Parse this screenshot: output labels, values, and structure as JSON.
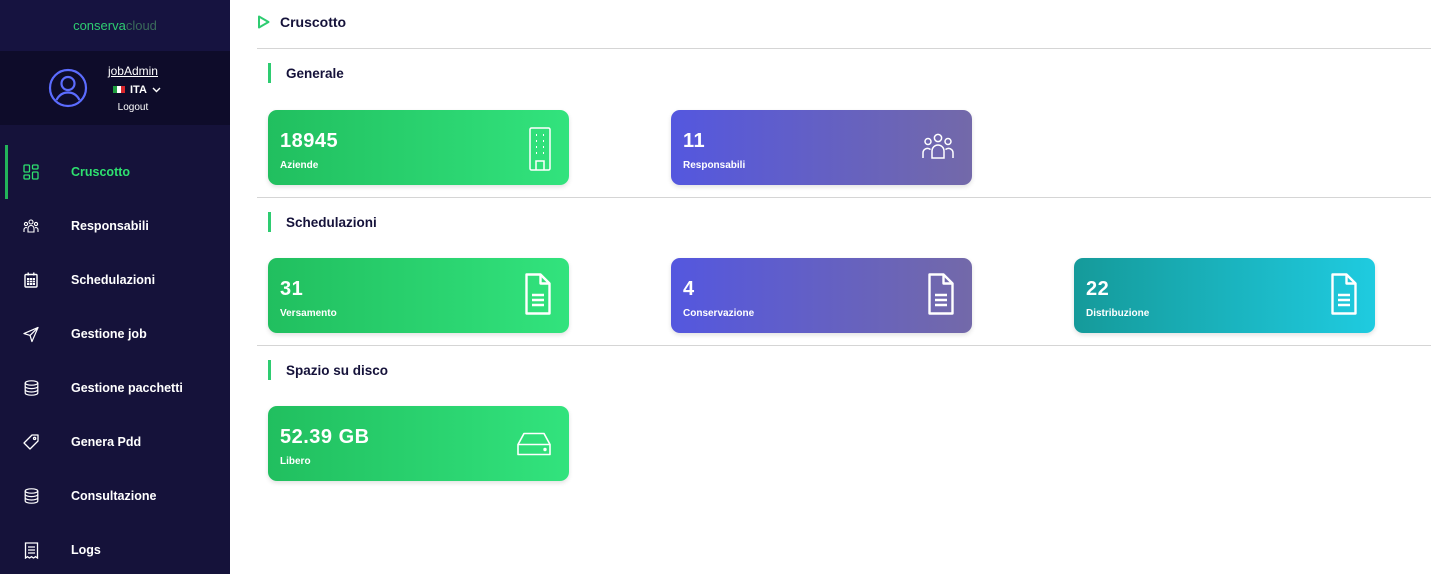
{
  "brand": {
    "part1": "conserva",
    "part2": "cloud"
  },
  "user": {
    "name": "jobAdmin",
    "language": "ITA",
    "logout": "Logout"
  },
  "nav": [
    {
      "label": "Cruscotto",
      "icon": "dashboard-icon",
      "active": true
    },
    {
      "label": "Responsabili",
      "icon": "users-icon",
      "active": false
    },
    {
      "label": "Schedulazioni",
      "icon": "calendar-icon",
      "active": false
    },
    {
      "label": "Gestione job",
      "icon": "send-icon",
      "active": false
    },
    {
      "label": "Gestione pacchetti",
      "icon": "database-icon",
      "active": false
    },
    {
      "label": "Genera Pdd",
      "icon": "tag-icon",
      "active": false
    },
    {
      "label": "Consultazione",
      "icon": "database-icon",
      "active": false
    },
    {
      "label": "Logs",
      "icon": "receipt-icon",
      "active": false
    }
  ],
  "page": {
    "title": "Cruscotto"
  },
  "sections": {
    "generale": {
      "title": "Generale",
      "cards": [
        {
          "value": "18945",
          "label": "Aziende",
          "icon": "building-icon",
          "color": "#21bf5f"
        },
        {
          "value": "11",
          "label": "Responsabili",
          "icon": "users-icon",
          "color": "#5457df"
        }
      ]
    },
    "schedulazioni": {
      "title": "Schedulazioni",
      "cards": [
        {
          "value": "31",
          "label": "Versamento",
          "icon": "document-icon",
          "color": "#21bf5f"
        },
        {
          "value": "4",
          "label": "Conservazione",
          "icon": "document-icon",
          "color": "#5457df"
        },
        {
          "value": "22",
          "label": "Distribuzione",
          "icon": "document-icon",
          "color": "#159a9a"
        }
      ]
    },
    "spazio": {
      "title": "Spazio su disco",
      "cards": [
        {
          "value": "52.39 GB",
          "label": "Libero",
          "icon": "harddisk-icon",
          "color": "#21bf5f"
        }
      ]
    }
  },
  "colors": {
    "sidebar": "#15123a",
    "accent": "#2ecc71",
    "purple": "#5457df",
    "teal": "#1fcbe0"
  }
}
